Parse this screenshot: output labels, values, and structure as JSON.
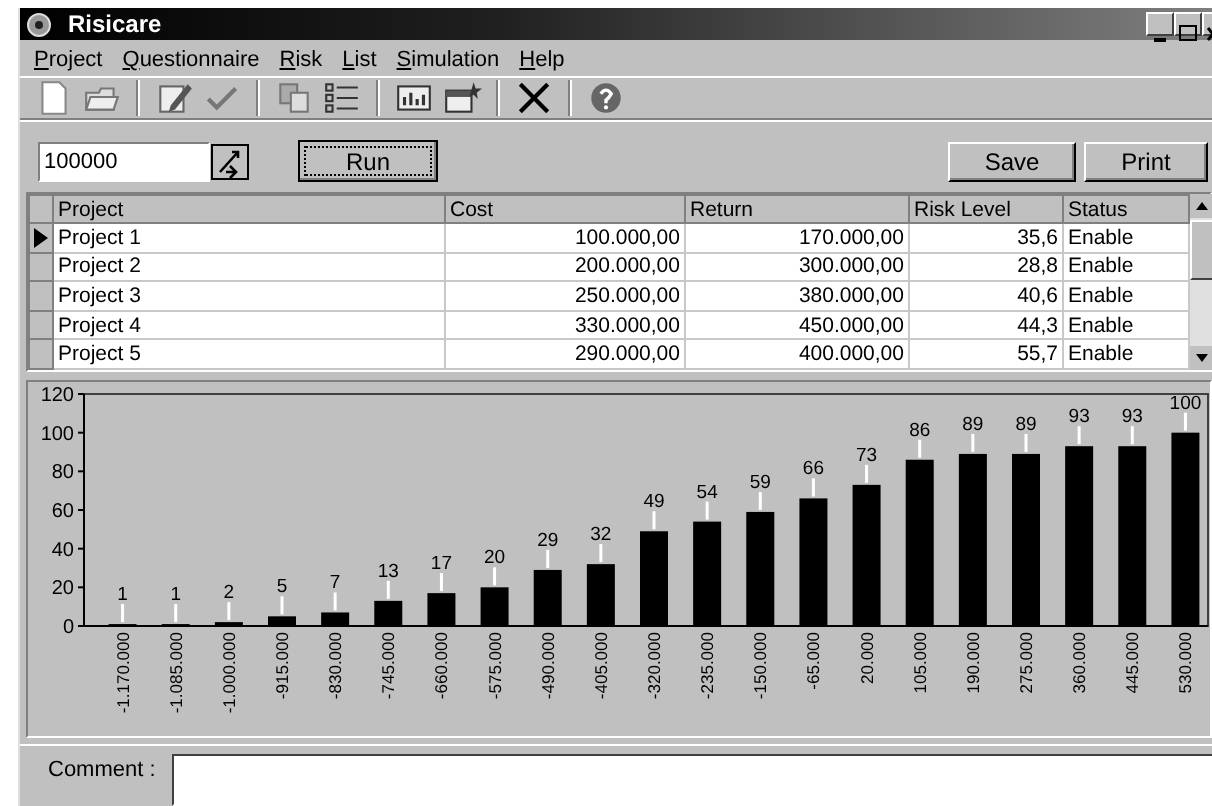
{
  "window": {
    "title": "Risicare"
  },
  "menu": [
    "Project",
    "Questionnaire",
    "Risk",
    "List",
    "Simulation",
    "Help"
  ],
  "run_bar": {
    "amount": "100000",
    "run_button": "Run",
    "save_button": "Save",
    "print_button": "Print"
  },
  "table": {
    "columns": [
      "Project",
      "Cost",
      "Return",
      "Risk Level",
      "Status"
    ],
    "rows": [
      {
        "cells": [
          "Project 1",
          "100.000,00",
          "170.000,00",
          "35,6",
          "Enable"
        ],
        "selected": true
      },
      {
        "cells": [
          "Project 2",
          "200.000,00",
          "300.000,00",
          "28,8",
          "Enable"
        ],
        "selected": false
      },
      {
        "cells": [
          "Project 3",
          "250.000,00",
          "380.000,00",
          "40,6",
          "Enable"
        ],
        "selected": false
      },
      {
        "cells": [
          "Project 4",
          "330.000,00",
          "450.000,00",
          "44,3",
          "Enable"
        ],
        "selected": false
      },
      {
        "cells": [
          "Project 5",
          "290.000,00",
          "400.000,00",
          "55,7",
          "Enable"
        ],
        "selected": false
      }
    ]
  },
  "chart": {
    "chart_data": {
      "type": "bar",
      "categories": [
        "-1.170.000",
        "-1.085.000",
        "-1.000.000",
        "-915.000",
        "-830.000",
        "-745.000",
        "-660.000",
        "-575.000",
        "-490.000",
        "-405.000",
        "-320.000",
        "-235.000",
        "-150.000",
        "-65.000",
        "20.000",
        "105.000",
        "190.000",
        "275.000",
        "360.000",
        "445.000",
        "530.000"
      ],
      "values": [
        1,
        1,
        2,
        5,
        7,
        13,
        17,
        20,
        29,
        32,
        49,
        54,
        59,
        66,
        73,
        86,
        89,
        89,
        93,
        93,
        100
      ],
      "ylim": [
        0,
        120
      ],
      "yticks": [
        0,
        20,
        40,
        60,
        80,
        100,
        120
      ],
      "data_labels": true
    }
  },
  "comment": {
    "label": "Comment :"
  }
}
